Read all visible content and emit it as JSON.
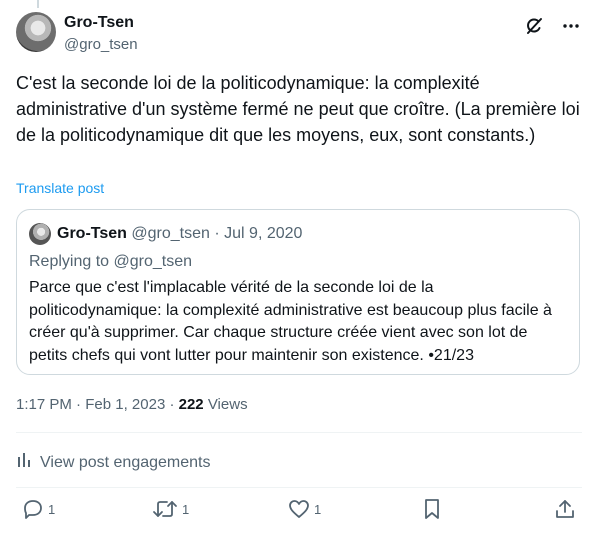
{
  "author": {
    "name": "Gro-Tsen",
    "handle": "@gro_tsen"
  },
  "post": {
    "text": "C'est la seconde loi de la politicodynamique: la complexité administrative d'un système fermé ne peut que croître. (La première loi de la politicodynamique dit que les moyens, eux, sont constants.)",
    "translate_label": "Translate post"
  },
  "quote": {
    "name": "Gro-Tsen",
    "handle": "@gro_tsen",
    "separator": "·",
    "date": "Jul 9, 2020",
    "replying_to": "Replying to @gro_tsen",
    "text": "Parce que c'est l'implacable vérité de la seconde loi de la politicodynamique: la complexité administrative est beaucoup plus facile à créer qu'à supprimer. Car chaque structure créée vient avec son lot de petits chefs qui vont lutter pour maintenir son existence. •21/23"
  },
  "meta": {
    "time": "1:17 PM",
    "separator": "·",
    "date": "Feb 1, 2023",
    "views_count": "222",
    "views_label": "Views"
  },
  "engagements": {
    "label": "View post engagements"
  },
  "actions": {
    "reply_count": "1",
    "repost_count": "1",
    "like_count": "1"
  },
  "icons": {
    "grok": "grok-icon",
    "more": "more-icon",
    "stats": "bar-chart-icon",
    "reply": "reply-icon",
    "repost": "repost-icon",
    "like": "heart-icon",
    "bookmark": "bookmark-icon",
    "share": "share-icon"
  },
  "colors": {
    "link": "#1d9bf0",
    "secondary_text": "#536471",
    "primary_text": "#0f1419",
    "border": "#cfd9de"
  }
}
